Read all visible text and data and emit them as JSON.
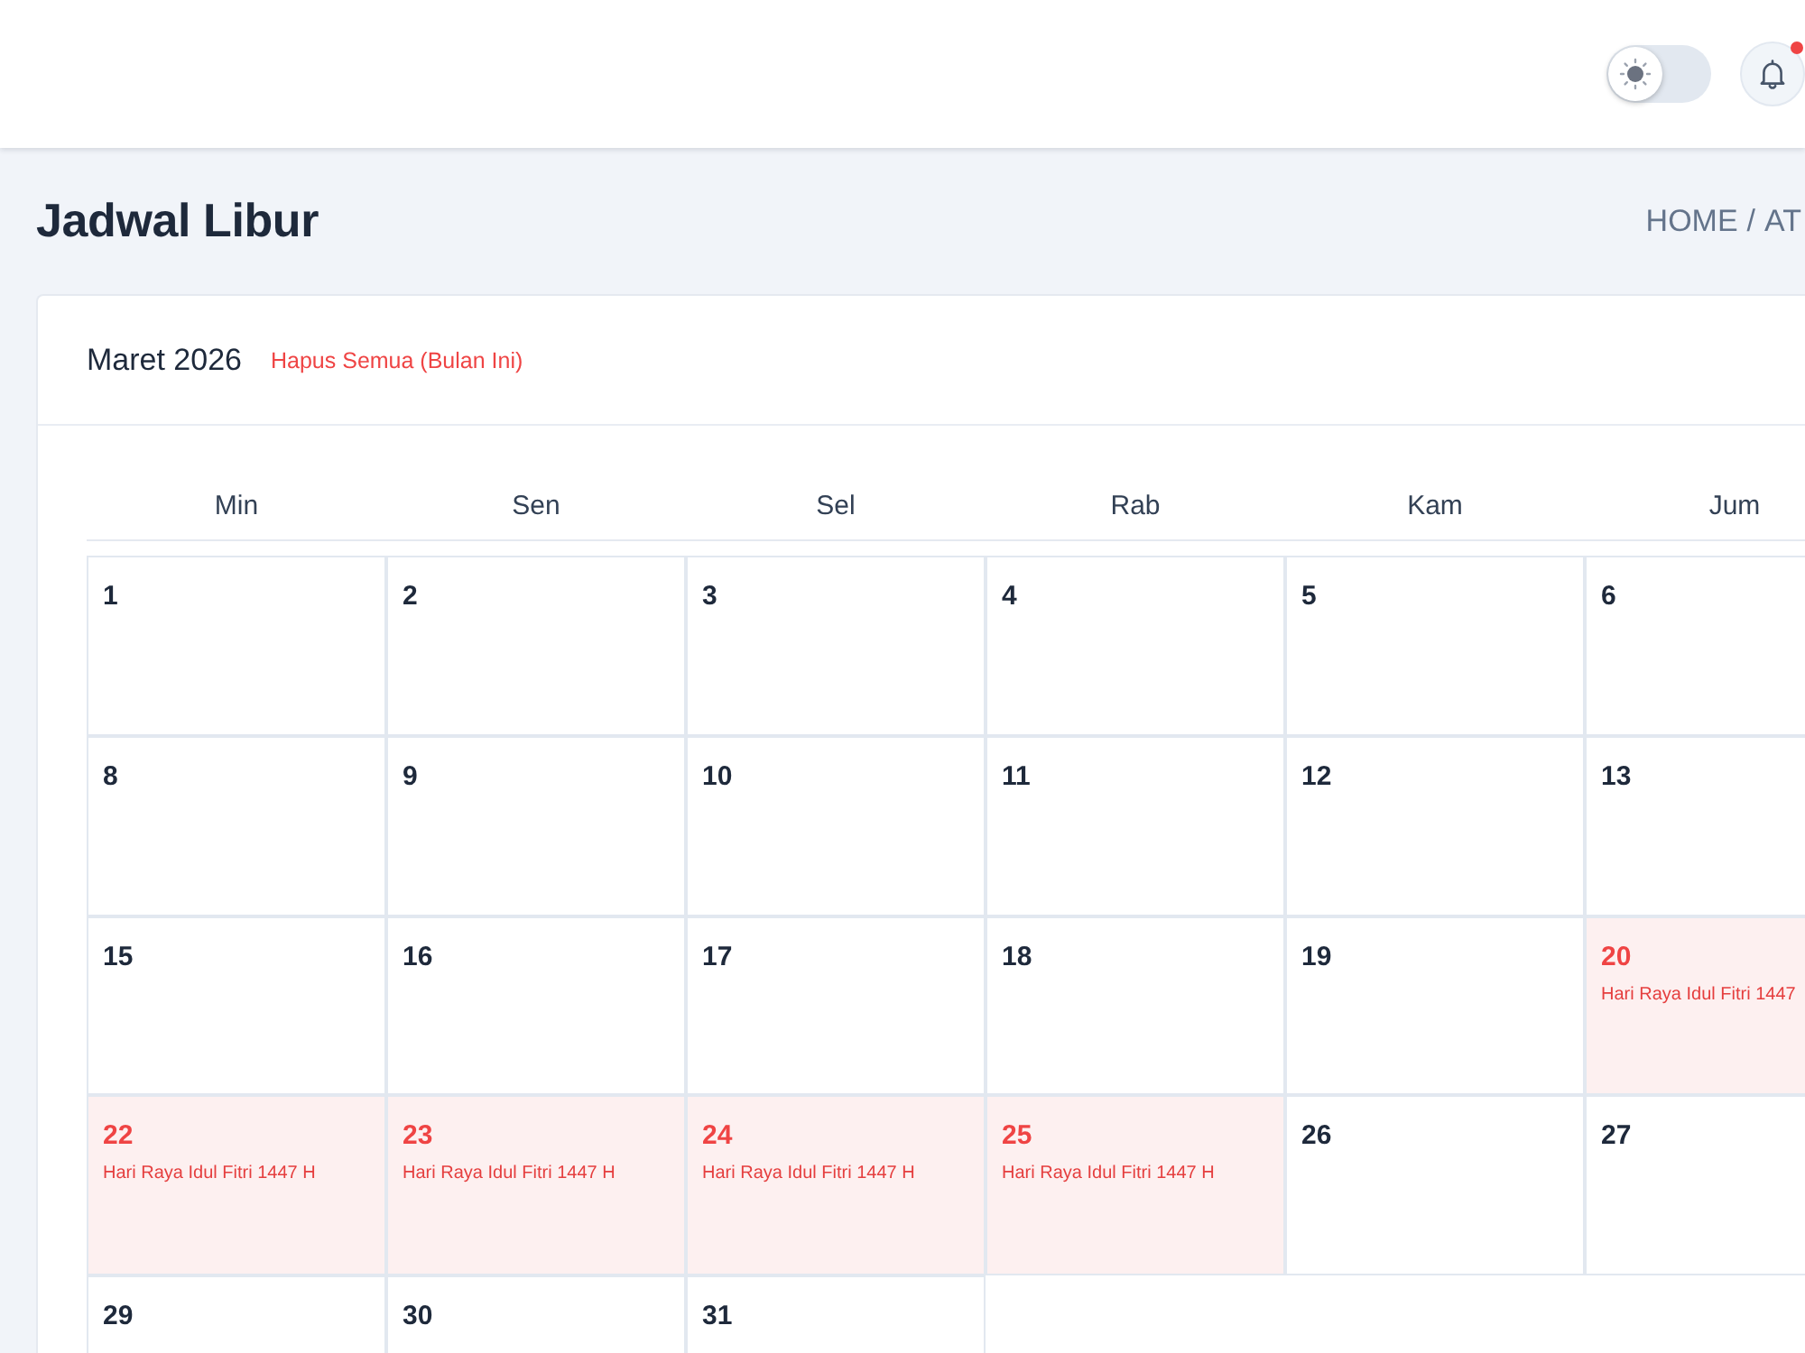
{
  "header": {
    "theme_toggle": {
      "on": false
    },
    "notifications": {
      "unread": true
    }
  },
  "page": {
    "title": "Jadwal Libur",
    "breadcrumb": {
      "items": [
        "HOME",
        "AT"
      ],
      "separator": "/"
    }
  },
  "calendar": {
    "month": "Maret 2026",
    "clear_link": "Hapus Semua (Bulan Ini)",
    "weekdays": [
      "Min",
      "Sen",
      "Sel",
      "Rab",
      "Kam",
      "Jum"
    ],
    "weeks": [
      [
        {
          "day": "1",
          "holiday": false
        },
        {
          "day": "2",
          "holiday": false
        },
        {
          "day": "3",
          "holiday": false
        },
        {
          "day": "4",
          "holiday": false
        },
        {
          "day": "5",
          "holiday": false
        },
        {
          "day": "6",
          "holiday": false
        }
      ],
      [
        {
          "day": "8",
          "holiday": false
        },
        {
          "day": "9",
          "holiday": false
        },
        {
          "day": "10",
          "holiday": false
        },
        {
          "day": "11",
          "holiday": false
        },
        {
          "day": "12",
          "holiday": false
        },
        {
          "day": "13",
          "holiday": false
        }
      ],
      [
        {
          "day": "15",
          "holiday": false
        },
        {
          "day": "16",
          "holiday": false
        },
        {
          "day": "17",
          "holiday": false
        },
        {
          "day": "18",
          "holiday": false
        },
        {
          "day": "19",
          "holiday": false
        },
        {
          "day": "20",
          "holiday": true,
          "event": "Hari Raya Idul Fitri 1447"
        }
      ],
      [
        {
          "day": "22",
          "holiday": true,
          "event": "Hari Raya Idul Fitri 1447 H"
        },
        {
          "day": "23",
          "holiday": true,
          "event": "Hari Raya Idul Fitri 1447 H"
        },
        {
          "day": "24",
          "holiday": true,
          "event": "Hari Raya Idul Fitri 1447 H"
        },
        {
          "day": "25",
          "holiday": true,
          "event": "Hari Raya Idul Fitri 1447 H"
        },
        {
          "day": "26",
          "holiday": false
        },
        {
          "day": "27",
          "holiday": false
        }
      ],
      [
        {
          "day": "29",
          "holiday": false
        },
        {
          "day": "30",
          "holiday": false
        },
        {
          "day": "31",
          "holiday": false
        }
      ]
    ]
  }
}
